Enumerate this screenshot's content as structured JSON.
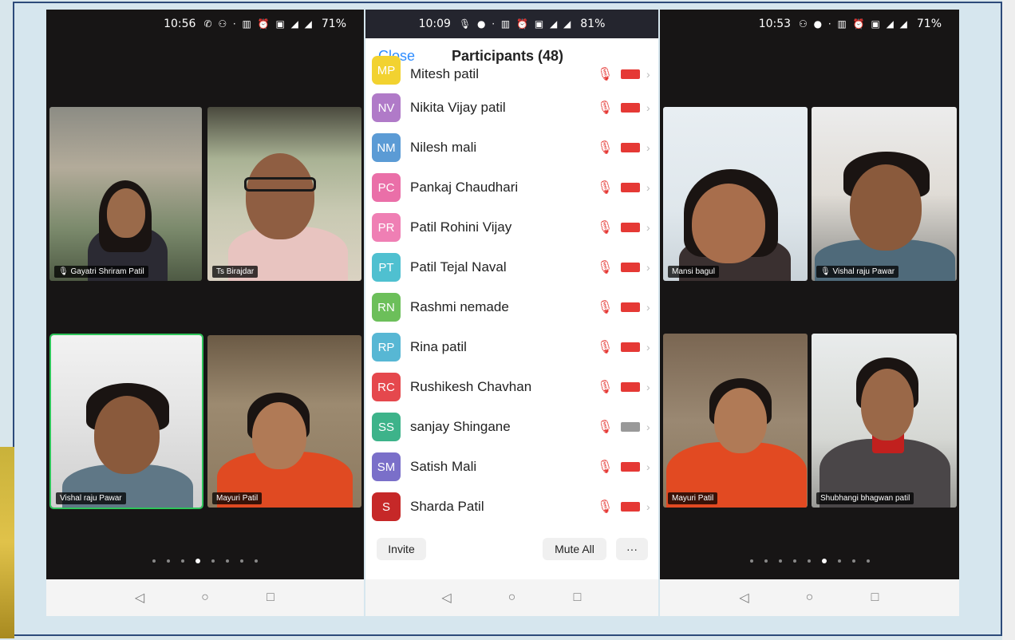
{
  "phone_left": {
    "time": "10:56",
    "battery": "71%",
    "tiles": [
      {
        "name": "Gayatri Shriram Patil"
      },
      {
        "name": "Ts Birajdar"
      },
      {
        "name": "Vishal raju Pawar"
      },
      {
        "name": "Mayuri Patil"
      }
    ],
    "page_dots": 8,
    "active_dot": 4
  },
  "phone_middle": {
    "time": "10:09",
    "battery": "81%",
    "close_label": "Close",
    "title": "Participants (48)",
    "participants": [
      {
        "initials": "MP",
        "name": "Mitesh patil",
        "color": "#f2d230",
        "video_on": false
      },
      {
        "initials": "NV",
        "name": "Nikita Vijay patil",
        "color": "#b07ac8",
        "video_on": false
      },
      {
        "initials": "NM",
        "name": "Nilesh mali",
        "color": "#5b9bd5",
        "video_on": false
      },
      {
        "initials": "PC",
        "name": "Pankaj Chaudhari",
        "color": "#ea6fa8",
        "video_on": false
      },
      {
        "initials": "PR",
        "name": "Patil Rohini Vijay",
        "color": "#ef7fb4",
        "video_on": false
      },
      {
        "initials": "PT",
        "name": "Patil Tejal Naval",
        "color": "#4fc0d0",
        "video_on": false
      },
      {
        "initials": "RN",
        "name": "Rashmi nemade",
        "color": "#6cbf5a",
        "video_on": false
      },
      {
        "initials": "RP",
        "name": "Rina patil",
        "color": "#57b7d4",
        "video_on": false
      },
      {
        "initials": "RC",
        "name": "Rushikesh Chavhan",
        "color": "#e5484d",
        "video_on": false
      },
      {
        "initials": "SS",
        "name": "sanjay Shingane",
        "color": "#3db38a",
        "video_on": true
      },
      {
        "initials": "SM",
        "name": "Satish Mali",
        "color": "#7a6fc9",
        "video_on": false
      },
      {
        "initials": "S",
        "name": "Sharda Patil",
        "color": "#c62828",
        "video_on": false
      }
    ],
    "invite_label": "Invite",
    "mute_all_label": "Mute All",
    "more_label": "···"
  },
  "phone_right": {
    "time": "10:53",
    "battery": "71%",
    "tiles": [
      {
        "name": "Mansi bagul"
      },
      {
        "name": "Vishal raju Pawar"
      },
      {
        "name": "Mayuri Patil"
      },
      {
        "name": "Shubhangi bhagwan patil"
      }
    ],
    "page_dots": 9,
    "active_dot": 5
  },
  "nav": {
    "back": "◁",
    "home": "○",
    "recents": "□"
  }
}
